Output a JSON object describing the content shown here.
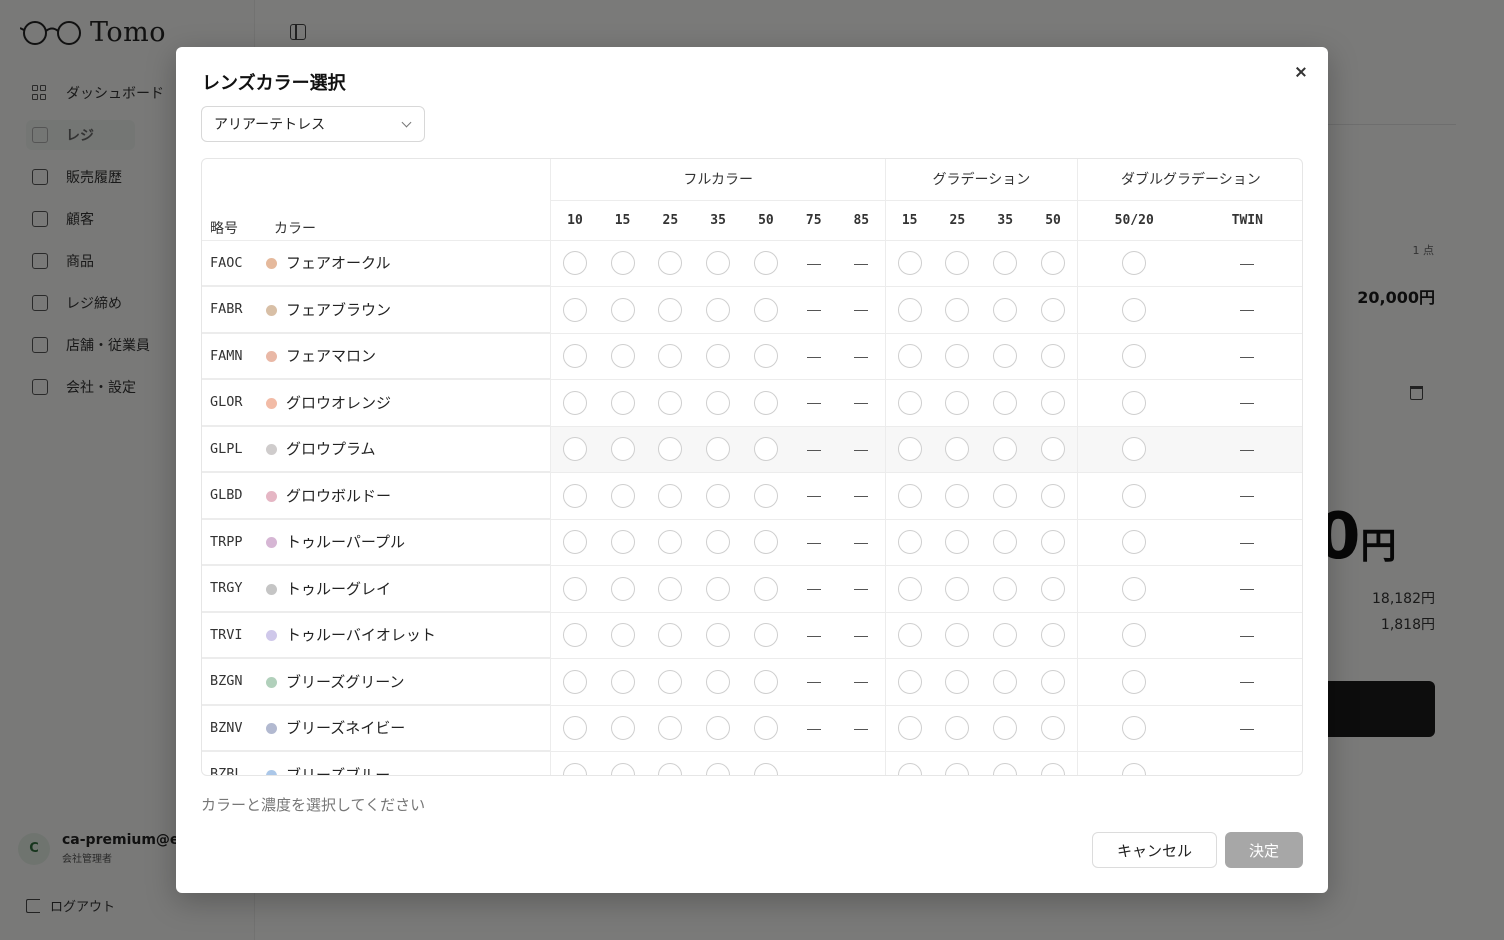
{
  "app": {
    "logo_text": "Tomo"
  },
  "sidebar": {
    "items": [
      {
        "label": "ダッシュボード",
        "icon": "grid-icon"
      },
      {
        "label": "レジ",
        "icon": "cart-icon",
        "active": true
      },
      {
        "label": "販売履歴",
        "icon": "clipboard-icon"
      },
      {
        "label": "顧客",
        "icon": "users-icon"
      },
      {
        "label": "商品",
        "icon": "box-icon"
      },
      {
        "label": "レジ締め",
        "icon": "receipt-icon"
      },
      {
        "label": "店舗・従業員",
        "icon": "building-icon"
      },
      {
        "label": "会社・設定",
        "icon": "gear-icon"
      }
    ],
    "user": {
      "initial": "C",
      "email": "ca-premium@ex",
      "role": "会社管理者"
    },
    "logout_label": "ログアウト"
  },
  "background": {
    "count": "1 点",
    "price": "20,000円",
    "big_total": "0",
    "big_unit": "円",
    "sub1": "18,182円",
    "sub2": "1,818円"
  },
  "modal": {
    "title": "レンズカラー選択",
    "select_value": "アリアーテトレス",
    "header": {
      "abbr": "略号",
      "color": "カラー",
      "groups": [
        {
          "label": "フルカラー",
          "cols": [
            "10",
            "15",
            "25",
            "35",
            "50",
            "75",
            "85"
          ]
        },
        {
          "label": "グラデーション",
          "cols": [
            "15",
            "25",
            "35",
            "50"
          ]
        },
        {
          "label": "ダブルグラデーション",
          "cols": [
            "50/20",
            "TWIN"
          ]
        }
      ]
    },
    "rows": [
      {
        "code": "FAOC",
        "name": "フェアオークル",
        "swatch": "#e5b99c"
      },
      {
        "code": "FABR",
        "name": "フェアブラウン",
        "swatch": "#d8bfa6"
      },
      {
        "code": "FAMN",
        "name": "フェアマロン",
        "swatch": "#e9b8a6"
      },
      {
        "code": "GLOR",
        "name": "グロウオレンジ",
        "swatch": "#f2bba6"
      },
      {
        "code": "GLPL",
        "name": "グロウプラム",
        "swatch": "#cfcccc",
        "highlight": true
      },
      {
        "code": "GLBD",
        "name": "グロウボルドー",
        "swatch": "#e5b6c4"
      },
      {
        "code": "TRPP",
        "name": "トゥルーパープル",
        "swatch": "#d6b6d4"
      },
      {
        "code": "TRGY",
        "name": "トゥルーグレイ",
        "swatch": "#c5c5c5"
      },
      {
        "code": "TRVI",
        "name": "トゥルーバイオレット",
        "swatch": "#cfc8ea"
      },
      {
        "code": "BZGN",
        "name": "ブリーズグリーン",
        "swatch": "#b1d0bb"
      },
      {
        "code": "BZNV",
        "name": "ブリーズネイビー",
        "swatch": "#b2b9d0"
      },
      {
        "code": "BZBL",
        "name": "ブリーズブルー",
        "swatch": "#abc7e8"
      }
    ],
    "availability": [
      "radio",
      "radio",
      "radio",
      "radio",
      "radio",
      "dash",
      "dash",
      "radio",
      "radio",
      "radio",
      "radio",
      "radio",
      "dash"
    ],
    "hint": "カラーと濃度を選択してください",
    "cancel_label": "キャンセル",
    "ok_label": "決定"
  }
}
